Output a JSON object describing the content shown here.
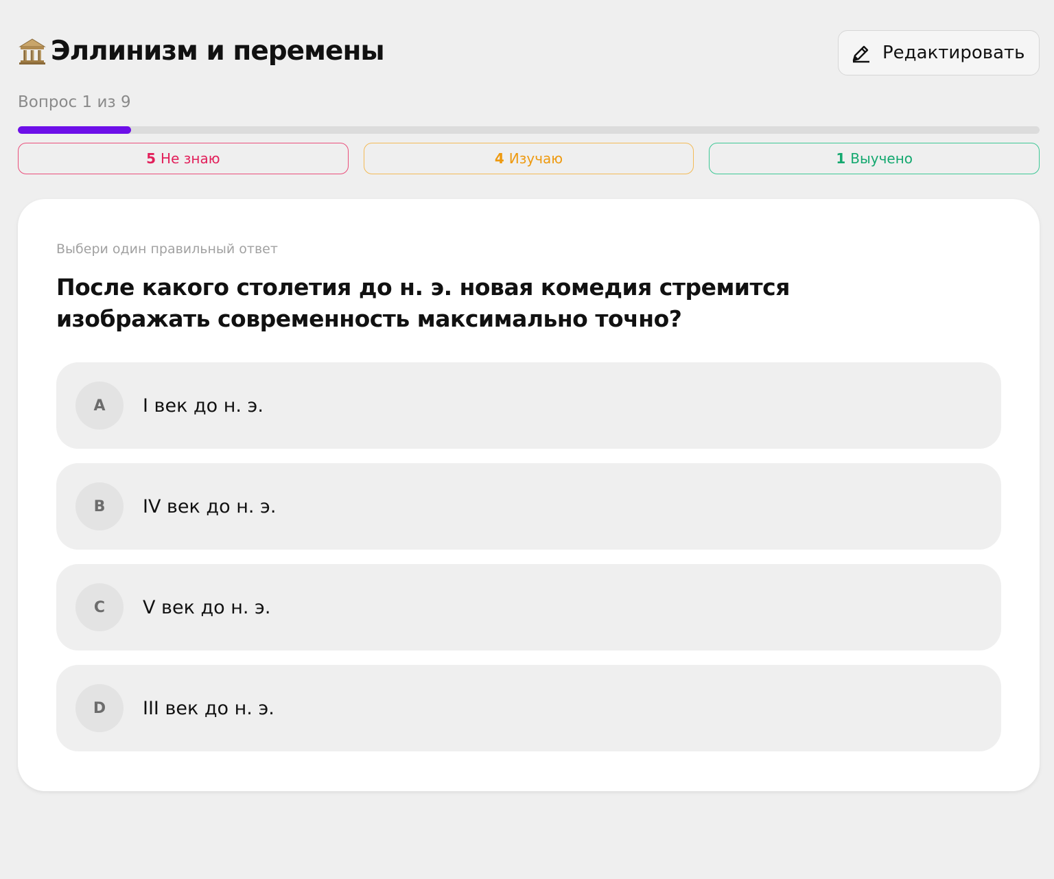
{
  "header": {
    "icon": "classical-building-icon",
    "title": "Эллинизм и перемены",
    "edit_icon": "pencil-icon",
    "edit_label": "Редактировать"
  },
  "progress": {
    "label": "Вопрос 1 из 9",
    "current": 1,
    "total": 9,
    "fill_fraction": 0.111,
    "color": "#6d0fe8"
  },
  "status": {
    "unknown": {
      "count": "5",
      "label": "Не знаю",
      "color": "#e21f5a"
    },
    "learning": {
      "count": "4",
      "label": "Изучаю",
      "color": "#ee9a10"
    },
    "learned": {
      "count": "1",
      "label": "Выучено",
      "color": "#14a86f"
    }
  },
  "card": {
    "instruction": "Выбери один правильный ответ",
    "question": "После какого столетия до н. э. новая комедия стремится изображать современность максимально точно?",
    "options": [
      {
        "letter": "A",
        "text": "I век до н. э."
      },
      {
        "letter": "B",
        "text": "IV век до н. э."
      },
      {
        "letter": "C",
        "text": "V век до н. э."
      },
      {
        "letter": "D",
        "text": "III век до н. э."
      }
    ]
  }
}
